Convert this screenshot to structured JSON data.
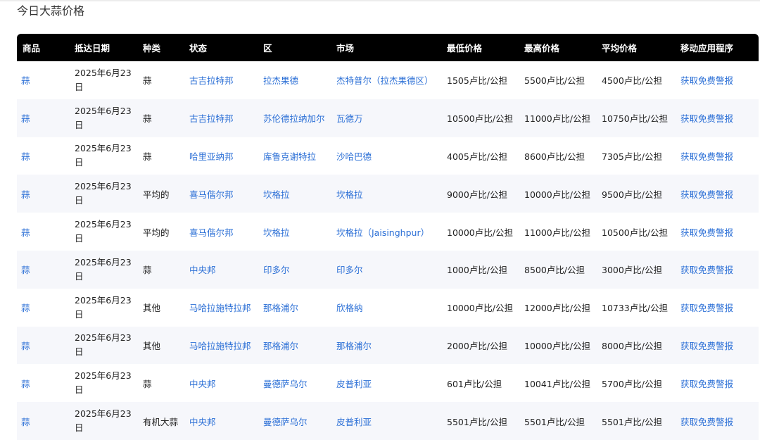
{
  "page": {
    "title": "今日大蒜价格"
  },
  "table": {
    "headers": [
      "商品",
      "抵达日期",
      "种类",
      "状态",
      "区",
      "市场",
      "最低价格",
      "最高价格",
      "平均价格",
      "移动应用程序"
    ],
    "rows": [
      [
        "蒜",
        "2025年6月23日",
        "蒜",
        "古吉拉特邦",
        "拉杰果德",
        "杰特普尔（拉杰果德区）",
        "1505卢比/公担",
        "5500卢比/公担",
        "4500卢比/公担",
        "获取免费警报"
      ],
      [
        "蒜",
        "2025年6月23日",
        "蒜",
        "古吉拉特邦",
        "苏伦德拉纳加尔",
        "瓦德万",
        "10500卢比/公担",
        "11000卢比/公担",
        "10750卢比/公担",
        "获取免费警报"
      ],
      [
        "蒜",
        "2025年6月23日",
        "蒜",
        "哈里亚纳邦",
        "库鲁克谢特拉",
        "沙哈巴德",
        "4005卢比/公担",
        "8600卢比/公担",
        "7305卢比/公担",
        "获取免费警报"
      ],
      [
        "蒜",
        "2025年6月23日",
        "平均的",
        "喜马偕尔邦",
        "坎格拉",
        "坎格拉",
        "9000卢比/公担",
        "10000卢比/公担",
        "9500卢比/公担",
        "获取免费警报"
      ],
      [
        "蒜",
        "2025年6月23日",
        "平均的",
        "喜马偕尔邦",
        "坎格拉",
        "坎格拉（Jaisinghpur）",
        "10000卢比/公担",
        "11000卢比/公担",
        "10500卢比/公担",
        "获取免费警报"
      ],
      [
        "蒜",
        "2025年6月23日",
        "蒜",
        "中央邦",
        "印多尔",
        "印多尔",
        "1000卢比/公担",
        "8500卢比/公担",
        "3000卢比/公担",
        "获取免费警报"
      ],
      [
        "蒜",
        "2025年6月23日",
        "其他",
        "马哈拉施特拉邦",
        "那格浦尔",
        "欣格纳",
        "10000卢比/公担",
        "12000卢比/公担",
        "10733卢比/公担",
        "获取免费警报"
      ],
      [
        "蒜",
        "2025年6月23日",
        "其他",
        "马哈拉施特拉邦",
        "那格浦尔",
        "那格浦尔",
        "2000卢比/公担",
        "10000卢比/公担",
        "8000卢比/公担",
        "获取免费警报"
      ],
      [
        "蒜",
        "2025年6月23日",
        "蒜",
        "中央邦",
        "曼德萨乌尔",
        "皮普利亚",
        "601卢比/公担",
        "10041卢比/公担",
        "5700卢比/公担",
        "获取免费警报"
      ],
      [
        "蒜",
        "2025年6月23日",
        "有机大蒜",
        "中央邦",
        "曼德萨乌尔",
        "皮普利亚",
        "5501卢比/公担",
        "5501卢比/公担",
        "5501卢比/公担",
        "获取免费警报"
      ]
    ]
  },
  "colors": {
    "link": "#2b6fd6",
    "header_bg": "#000000",
    "row_alt_bg": "#f6f7fb"
  }
}
